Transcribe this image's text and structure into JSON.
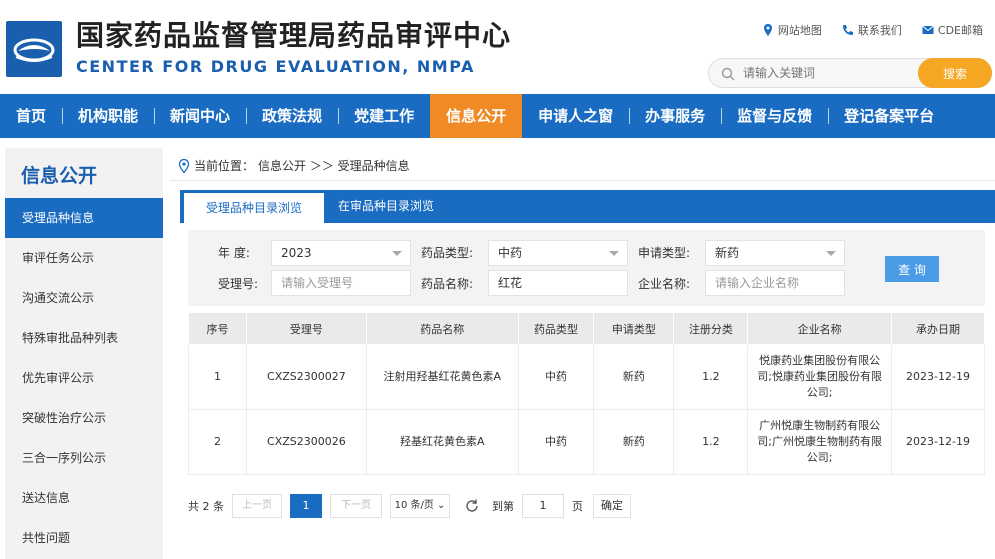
{
  "header": {
    "title_cn": "国家药品监督管理局药品审评中心",
    "title_en": "CENTER FOR DRUG EVALUATION, NMPA",
    "links": {
      "sitemap": "网站地图",
      "contact": "联系我们",
      "mail": "CDE邮箱"
    },
    "search": {
      "placeholder": "请输入关键词",
      "button": "搜索"
    }
  },
  "nav": [
    "首页",
    "机构职能",
    "新闻中心",
    "政策法规",
    "党建工作",
    "信息公开",
    "申请人之窗",
    "办事服务",
    "监督与反馈",
    "登记备案平台"
  ],
  "sidebar": {
    "title": "信息公开",
    "items": [
      "受理品种信息",
      "审评任务公示",
      "沟通交流公示",
      "特殊审批品种列表",
      "优先审评公示",
      "突破性治疗公示",
      "三合一序列公示",
      "送达信息",
      "共性问题"
    ]
  },
  "breadcrumb": {
    "prefix": "当前位置：",
    "path": "信息公开 ＞＞ 受理品种信息"
  },
  "tabs": {
    "active": "受理品种目录浏览",
    "inactive": "在审品种目录浏览"
  },
  "filters": {
    "year_label": "年    度:",
    "year_value": "2023",
    "drug_type_label": "药品类型:",
    "drug_type_value": "中药",
    "apply_type_label": "申请类型:",
    "apply_type_value": "新药",
    "accept_no_label": "受理号:",
    "accept_no_placeholder": "请输入受理号",
    "drug_name_label": "药品名称:",
    "drug_name_value": "红花",
    "company_label": "企业名称:",
    "company_placeholder": "请输入企业名称",
    "query_button": "查 询"
  },
  "table": {
    "headers": [
      "序号",
      "受理号",
      "药品名称",
      "药品类型",
      "申请类型",
      "注册分类",
      "企业名称",
      "承办日期"
    ],
    "rows": [
      [
        "1",
        "CXZS2300027",
        "注射用羟基红花黄色素A",
        "中药",
        "新药",
        "1.2",
        "悦康药业集团股份有限公司;悦康药业集团股份有限公司;",
        "2023-12-19"
      ],
      [
        "2",
        "CXZS2300026",
        "羟基红花黄色素A",
        "中药",
        "新药",
        "1.2",
        "广州悦康生物制药有限公司;广州悦康生物制药有限公司;",
        "2023-12-19"
      ]
    ]
  },
  "pagination": {
    "total": "共 2 条",
    "prev": "上一页",
    "current": "1",
    "next": "下一页",
    "page_size": "10 条/页 ⌄",
    "goto_label": "到第",
    "goto_value": "1",
    "page_unit": "页",
    "confirm": "确定"
  }
}
